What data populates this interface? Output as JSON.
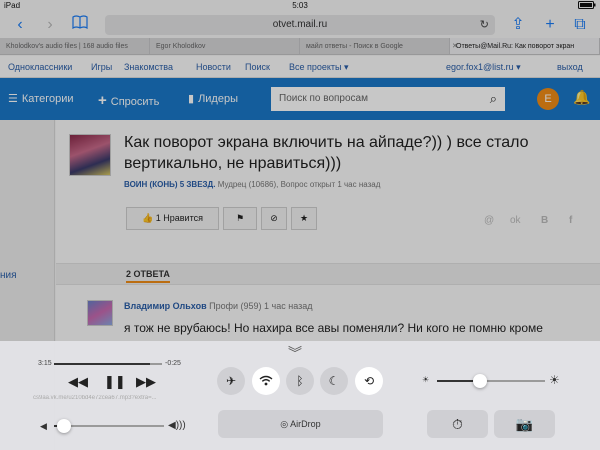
{
  "status": {
    "device": "iPad",
    "time": "5:03",
    "battery": ""
  },
  "toolbar": {
    "back_icon": "‹",
    "forward_icon": "›",
    "bookmarks_icon": "book-icon",
    "url": "otvet.mail.ru",
    "reload_icon": "↻",
    "share_icon": "⇪",
    "new_tab_icon": "+",
    "tabs_icon": "⧉"
  },
  "tabs": [
    {
      "label": "Kholodkov's audio files | 168 audio files"
    },
    {
      "label": "Egor Kholodkov"
    },
    {
      "label": "майл ответы - Поиск в Google"
    },
    {
      "label": "Ответы@Mail.Ru: Как поворот экран"
    }
  ],
  "portal": {
    "links": [
      "Одноклассники",
      "Игры",
      "Знакомства",
      "Новости",
      "Поиск",
      "Все проекты ▾"
    ],
    "user": "egor.fox1@list.ru ▾",
    "logout": "выход"
  },
  "header": {
    "categories": "Категории",
    "ask": "Спросить",
    "leaders": "Лидеры",
    "search_placeholder": "Поиск по вопросам",
    "avatar_letter": "E"
  },
  "sidebar": {
    "label": "ния"
  },
  "question": {
    "title": "Как поворот экрана включить на айпаде?)) ) все стало вертикально, не нравиться)))",
    "author": "ВОИН (КОНЬ) 5 ЗВЕЗД.",
    "meta": "Мудрец (10686), Вопрос открыт 1 час назад",
    "like_label": "1 Нравится",
    "share_icons": [
      "@",
      "ok",
      "B",
      "f"
    ]
  },
  "answers": {
    "count_label": "2 ОТВЕТА",
    "first": {
      "author": "Владимир Ольхов",
      "meta": "Профи (959) 1 час назад",
      "text": "я тож не врубаюсь! Но нахира все авы поменяли? Ни кого не помню кроме"
    }
  },
  "control_center": {
    "elapsed": "3:15",
    "remaining": "-0:25",
    "progress": 0.89,
    "track": "cs9aa.vk.me/u210bd4e72cea67.mp3?extra=...",
    "volume": 0.09,
    "brightness": 0.4,
    "airdrop_label": "AirDrop",
    "toggles": [
      {
        "name": "airplane",
        "icon": "✈",
        "on": false
      },
      {
        "name": "wifi",
        "icon": "wifi",
        "on": true
      },
      {
        "name": "bluetooth",
        "icon": "ᛒ",
        "on": false
      },
      {
        "name": "do-not-disturb",
        "icon": "☾",
        "on": false
      },
      {
        "name": "rotation-lock",
        "icon": "⟲",
        "on": true
      }
    ]
  }
}
